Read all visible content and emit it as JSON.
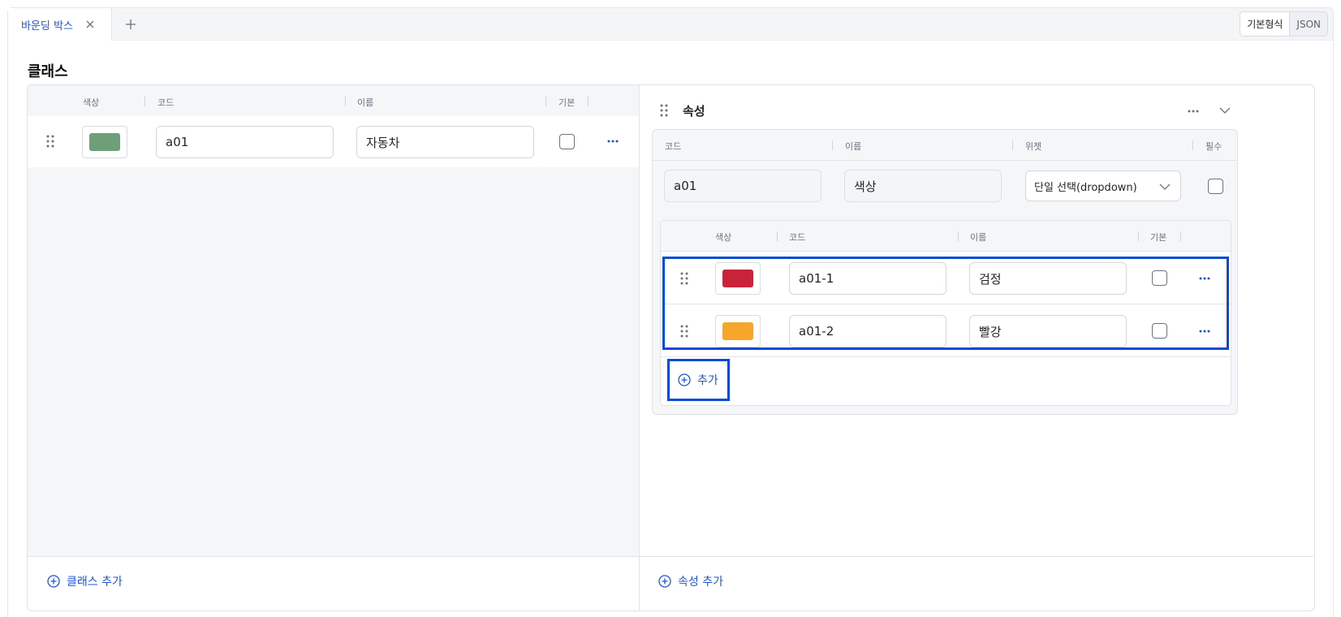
{
  "tab": {
    "label": "바운딩 박스"
  },
  "format": {
    "basic": "기본형식",
    "json": "JSON"
  },
  "section_title": "클래스",
  "class_table": {
    "headers": {
      "color": "색상",
      "code": "코드",
      "name": "이름",
      "default": "기본"
    },
    "rows": [
      {
        "color": "#6e9f78",
        "code": "a01",
        "name": "자동차",
        "default": false
      }
    ],
    "add_label": "클래스 추가"
  },
  "attribute": {
    "title": "속성",
    "headers": {
      "code": "코드",
      "name": "이름",
      "widget": "위젯",
      "required": "필수"
    },
    "row": {
      "code": "a01",
      "name": "색상",
      "widget": "단일 선택(dropdown)",
      "required": false
    },
    "options": {
      "headers": {
        "color": "색상",
        "code": "코드",
        "name": "이름",
        "default": "기본"
      },
      "rows": [
        {
          "color": "#c8233b",
          "code": "a01-1",
          "name": "검정",
          "default": false
        },
        {
          "color": "#f5a62b",
          "code": "a01-2",
          "name": "빨강",
          "default": false
        }
      ],
      "add_label": "추가"
    },
    "add_label": "속성 추가"
  },
  "colors": {
    "accent": "#1a56db",
    "highlight": "#0a4bd6"
  }
}
